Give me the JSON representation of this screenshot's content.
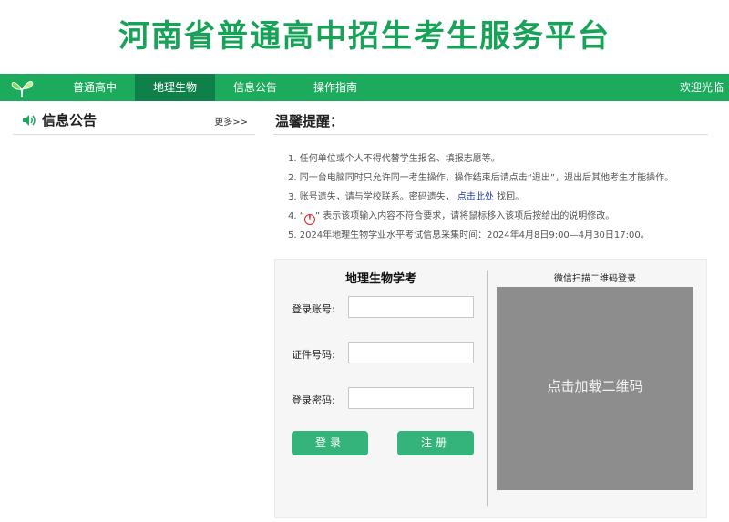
{
  "header": {
    "title": "河南省普通高中招生考生服务平台"
  },
  "nav": {
    "items": [
      {
        "label": "普通高中"
      },
      {
        "label": "地理生物"
      },
      {
        "label": "信息公告"
      },
      {
        "label": "操作指南"
      }
    ],
    "active": "地理生物",
    "welcome": "欢迎光临"
  },
  "announcements": {
    "title": "信息公告",
    "more": "更多>>"
  },
  "reminder": {
    "title": "温馨提醒：",
    "tips": {
      "t1": "1. 任何单位或个人不得代替学生报名、填报志愿等。",
      "t2": "2. 同一台电脑同时只允许同一考生操作，操作结束后请点击“退出”，退出后其他考生才能操作。",
      "t3_prefix": "3. 账号遗失，请与学校联系。密码遗失，",
      "t3_link": "点击此处",
      "t3_suffix": "找回。",
      "t4_prefix": "4. “",
      "t4_icon": "!",
      "t4_suffix": "” 表示该项输入内容不符合要求，请将鼠标移入该项后按给出的说明修改。",
      "t5": "5. 2024年地理生物学业水平考试信息采集时间：2024年4月8日9:00—4月30日17:00。"
    }
  },
  "login": {
    "title": "地理生物学考",
    "account_label": "登录账号:",
    "account_value": "",
    "id_label": "证件号码:",
    "id_value": "",
    "password_label": "登录密码:",
    "password_value": "",
    "login_button": "登录",
    "register_button": "注册"
  },
  "qr": {
    "title": "微信扫描二维码登录",
    "placeholder": "点击加载二维码"
  },
  "colors": {
    "brand_green": "#16a257",
    "nav_green": "#1caa5c",
    "nav_active": "#10804a",
    "button_green": "#34b47a",
    "link_blue": "#1d3aa8",
    "warning_red": "#e02020",
    "qr_gray": "#8d8d8d"
  }
}
